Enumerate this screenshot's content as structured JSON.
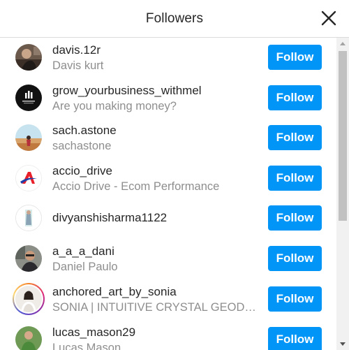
{
  "header": {
    "title": "Followers"
  },
  "follow_label": "Follow",
  "colors": {
    "accent": "#0095f6",
    "secondary_text": "#8e8e8e",
    "primary_text": "#262626",
    "divider": "#dbdbdb"
  },
  "followers": [
    {
      "username": "davis.12r",
      "full_name": "Davis kurt",
      "avatar": "photo-avatar-icon"
    },
    {
      "username": "grow_yourbusiness_withmel",
      "full_name": "Are you making money?",
      "avatar": "logo-avatar-icon"
    },
    {
      "username": "sach.astone",
      "full_name": "sachastone",
      "avatar": "photo-avatar-icon"
    },
    {
      "username": "accio_drive",
      "full_name": "Accio Drive - Ecom Performance",
      "avatar": "logo-avatar-icon"
    },
    {
      "username": "divyanshisharma1122",
      "full_name": "",
      "avatar": "photo-avatar-icon"
    },
    {
      "username": "a_a_a_dani",
      "full_name": "Daniel Paulo",
      "avatar": "photo-avatar-icon"
    },
    {
      "username": "anchored_art_by_sonia",
      "full_name": "SONIA | INTUITIVE CRYSTAL GEODE ...",
      "avatar": "story-ring-avatar-icon"
    },
    {
      "username": "lucas_mason29",
      "full_name": "Lucas Mason",
      "avatar": "photo-avatar-icon"
    }
  ]
}
